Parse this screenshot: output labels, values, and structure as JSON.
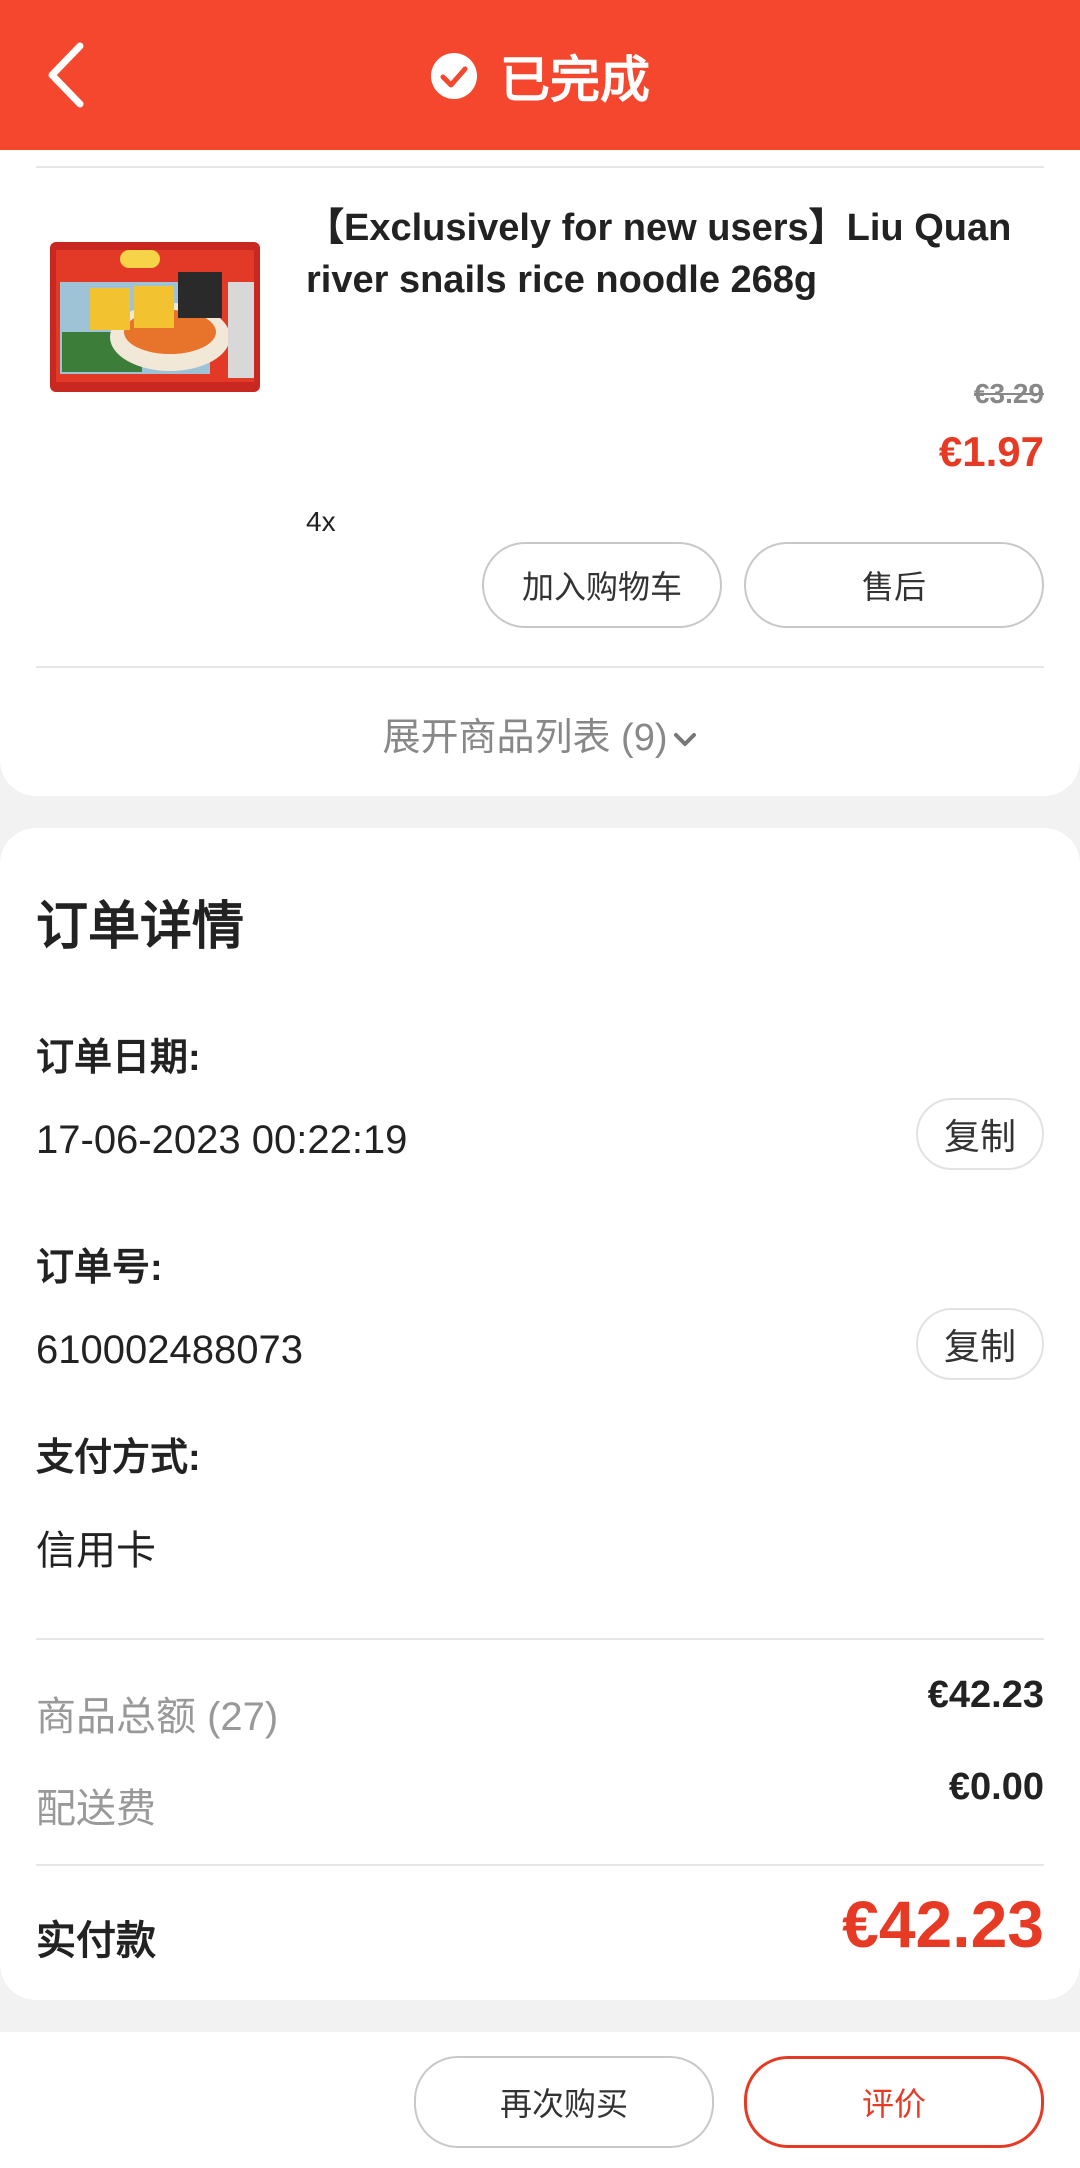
{
  "header": {
    "title": "已完成"
  },
  "product": {
    "name": "【Exclusively for new users】Liu Quan river snails rice noodle 268g",
    "original_price": "€3.29",
    "price": "€1.97",
    "quantity": "4x",
    "add_to_cart_label": "加入购物车",
    "after_sales_label": "售后"
  },
  "expand_list_label": "展开商品列表 (9)",
  "order_details": {
    "title": "订单详情",
    "date_label": "订单日期:",
    "date_value": "17-06-2023 00:22:19",
    "number_label": "订单号:",
    "number_value": "610002488073",
    "payment_label": "支付方式:",
    "payment_value": "信用卡",
    "copy_label": "复制"
  },
  "summary": {
    "subtotal_label": "商品总额 (27)",
    "subtotal_value": "€42.23",
    "shipping_label": "配送费",
    "shipping_value": "€0.00",
    "total_label": "实付款",
    "total_value": "€42.23"
  },
  "bottom_bar": {
    "rebuy_label": "再次购买",
    "review_label": "评价"
  },
  "colors": {
    "accent": "#f4472d",
    "price_red": "#e63a25"
  }
}
